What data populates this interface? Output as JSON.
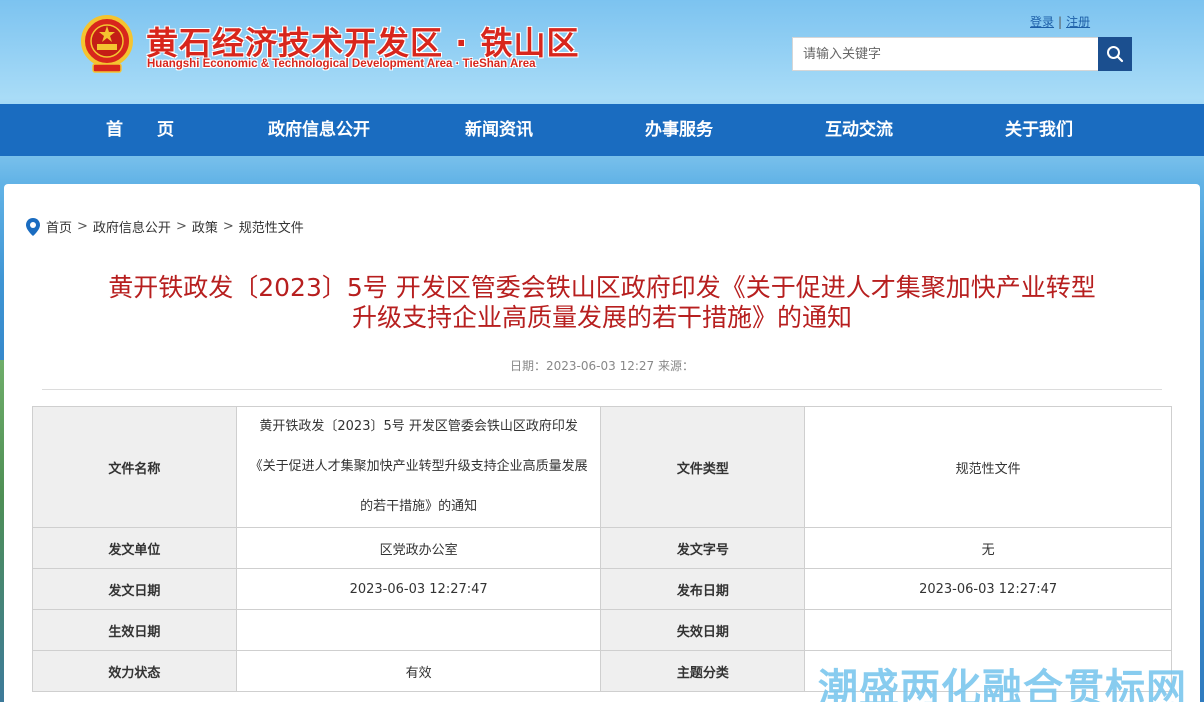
{
  "header": {
    "site_title": "黄石经济技术开发区 · 铁山区",
    "site_subtitle": "Huangshi Economic & Technological Development Area · TieShan Area",
    "login": "登录",
    "register": "注册",
    "search_placeholder": "请输入关键字"
  },
  "nav": {
    "items": [
      "首　　页",
      "政府信息公开",
      "新闻资讯",
      "办事服务",
      "互动交流",
      "关于我们"
    ]
  },
  "breadcrumb": {
    "items": [
      "首页",
      "政府信息公开",
      "政策",
      "规范性文件"
    ],
    "separator": ">"
  },
  "article": {
    "title_line1": "黄开铁政发〔2023〕5号 开发区管委会铁山区政府印发《关于促进人才集聚加快产业转型",
    "title_line2": "升级支持企业高质量发展的若干措施》的通知",
    "meta": "日期：2023-06-03 12:27 来源："
  },
  "info_table": {
    "labels": {
      "doc_name": "文件名称",
      "doc_type": "文件类型",
      "issuer": "发文单位",
      "doc_number": "发文字号",
      "issue_date": "发文日期",
      "publish_date": "发布日期",
      "effective_date": "生效日期",
      "expiry_date": "失效日期",
      "status": "效力状态",
      "category": "主题分类"
    },
    "values": {
      "doc_name_line1": "黄开铁政发〔2023〕5号 开发区管委会铁山区政府印发",
      "doc_name_line2": "《关于促进人才集聚加快产业转型升级支持企业高质量发展",
      "doc_name_line3": "的若干措施》的通知",
      "doc_type": "规范性文件",
      "issuer": "区党政办公室",
      "doc_number": "无",
      "issue_date": "2023-06-03 12:27:47",
      "publish_date": "2023-06-03 12:27:47",
      "effective_date": "",
      "expiry_date": "",
      "status": "有效",
      "category": ""
    }
  },
  "watermark": "潮盛两化融合贯标网",
  "colors": {
    "nav_bg": "#1a6cc0",
    "title_red": "#b71f1f",
    "brand_red": "#d8261c",
    "search_btn": "#1b4f8f"
  }
}
